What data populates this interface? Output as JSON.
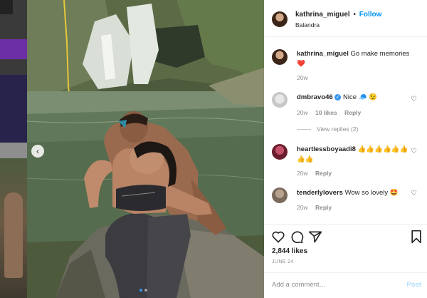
{
  "post": {
    "author": "kathrina_miguel",
    "separator": "•",
    "follow_label": "Follow",
    "location": "Balandra",
    "caption": "Go make memories",
    "caption_emoji": "❤️",
    "caption_time": "20w"
  },
  "comments": [
    {
      "user": "dmbravo46",
      "verified": true,
      "text": "Nice 🧢 😉",
      "time": "20w",
      "likes": "10 likes",
      "reply": "Reply",
      "view_replies": "View replies (2)"
    },
    {
      "user": "heartlessboyaadi8",
      "verified": false,
      "text": "👍👍👍👍👍👍👍👍",
      "time": "20w",
      "reply": "Reply"
    },
    {
      "user": "tenderlylovers",
      "verified": false,
      "text": "Wow so lovely 🤩",
      "time": "20w",
      "reply": "Reply"
    }
  ],
  "footer": {
    "likes": "2,844 likes",
    "date": "JUNE 24",
    "comment_placeholder": "Add a comment…",
    "post_label": "Post"
  },
  "icons": {
    "like": "heart-outline-icon",
    "comment": "comment-bubble-icon",
    "share": "paper-plane-icon",
    "save": "bookmark-icon",
    "prev": "chevron-left-icon"
  },
  "colors": {
    "accent": "#0095f6",
    "verified": "#3897f0",
    "heart": "#ed4956"
  }
}
